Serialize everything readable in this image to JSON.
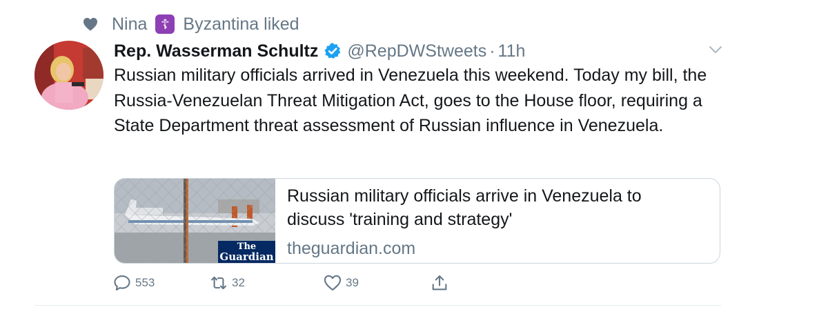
{
  "social_context": {
    "icon": "heart-icon",
    "name_before_badge": "Nina",
    "badge_glyph": "☦",
    "name_after_badge": "Byzantina liked"
  },
  "author": {
    "name": "Rep. Wasserman Schultz",
    "handle": "@RepDWStweets",
    "separator": "·",
    "time": "11h",
    "verified": true
  },
  "tweet": {
    "text": "Russian military officials arrived in Venezuela this weekend. Today my bill, the Russia-Venezuelan Threat Mitigation Act, goes to the House floor, requiring a State Department threat assessment of Russian influence in Venezuela."
  },
  "card": {
    "title": "Russian military officials arrive in Venezuela to discuss 'training and strategy'",
    "domain": "theguardian.com",
    "logo_line1": "The",
    "logo_line2": "Guardian"
  },
  "actions": {
    "reply_count": "553",
    "retweet_count": "32",
    "like_count": "39"
  },
  "colors": {
    "secondary_text": "#657786",
    "verified_blue": "#1da1f2",
    "badge_purple": "#8e3fb4",
    "guardian_blue": "#052962"
  }
}
